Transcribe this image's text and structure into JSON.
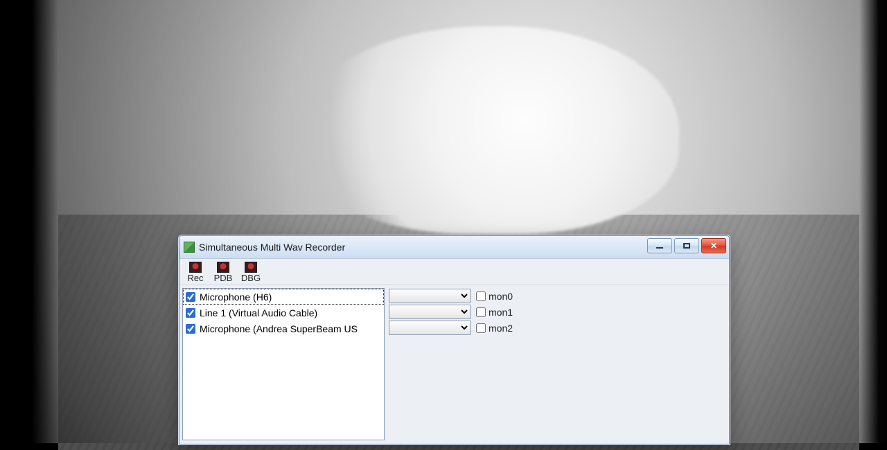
{
  "window": {
    "title": "Simultaneous Multi Wav Recorder"
  },
  "toolbar": {
    "rec_label": "Rec",
    "pdb_label": "PDB",
    "dbg_label": "DBG"
  },
  "devices": [
    {
      "checked": true,
      "name": "Microphone (H6)",
      "selected": true
    },
    {
      "checked": true,
      "name": "Line 1 (Virtual Audio Cable)",
      "selected": false
    },
    {
      "checked": true,
      "name": "Microphone (Andrea SuperBeam US",
      "selected": false
    }
  ],
  "monitors": [
    {
      "label": "mon0",
      "checked": false,
      "value": ""
    },
    {
      "label": "mon1",
      "checked": false,
      "value": ""
    },
    {
      "label": "mon2",
      "checked": false,
      "value": ""
    }
  ]
}
